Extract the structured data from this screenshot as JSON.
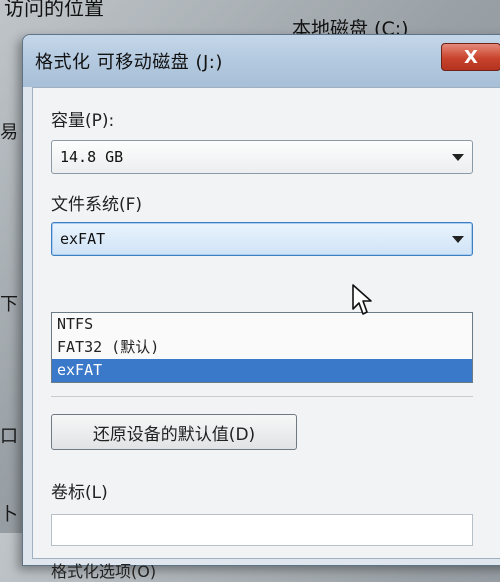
{
  "background": {
    "location_label": "访问的位置",
    "drive_label": "本地磁盘 (C:)",
    "fragments": [
      "易",
      "下",
      "口",
      "卜"
    ]
  },
  "dialog": {
    "title": "格式化 可移动磁盘 (J:)",
    "close_label": "X",
    "capacity": {
      "label": "容量(P):",
      "value": "14.8 GB"
    },
    "filesystem": {
      "label": "文件系统(F)",
      "value": "exFAT",
      "options": [
        "NTFS",
        "FAT32 (默认)",
        "exFAT"
      ],
      "selected_index": 2
    },
    "restore_button": "还原设备的默认值(D)",
    "volume_label": {
      "label": "卷标(L)",
      "value": ""
    },
    "format_options_label": "格式化选项(O)"
  },
  "colors": {
    "selection": "#3a78c9",
    "close_button": "#c8432c",
    "titlebar": "#b3c9df"
  },
  "icons": {
    "close": "x-glyph",
    "dropdown": "chevron-down",
    "cursor": "arrow-pointer"
  }
}
